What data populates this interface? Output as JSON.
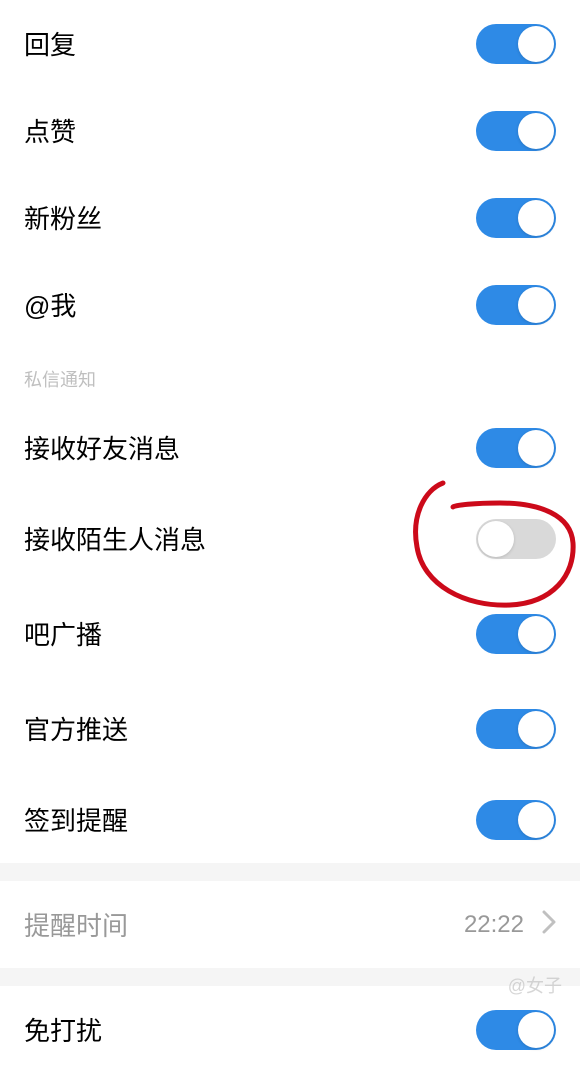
{
  "rows": {
    "reply": {
      "label": "回复",
      "on": true
    },
    "like": {
      "label": "点赞",
      "on": true
    },
    "newfans": {
      "label": "新粉丝",
      "on": true
    },
    "atme": {
      "label": "@我",
      "on": true
    },
    "friendmsg": {
      "label": "接收好友消息",
      "on": true
    },
    "strangermsg": {
      "label": "接收陌生人消息",
      "on": false
    },
    "broadcast": {
      "label": "吧广播",
      "on": true
    },
    "official": {
      "label": "官方推送",
      "on": true
    },
    "checkin": {
      "label": "签到提醒",
      "on": true
    },
    "dnd": {
      "label": "免打扰",
      "on": true
    }
  },
  "section_header": {
    "private_msg": "私信通知"
  },
  "reminder": {
    "label": "提醒时间",
    "value": "22:22"
  },
  "watermark": "@女子"
}
